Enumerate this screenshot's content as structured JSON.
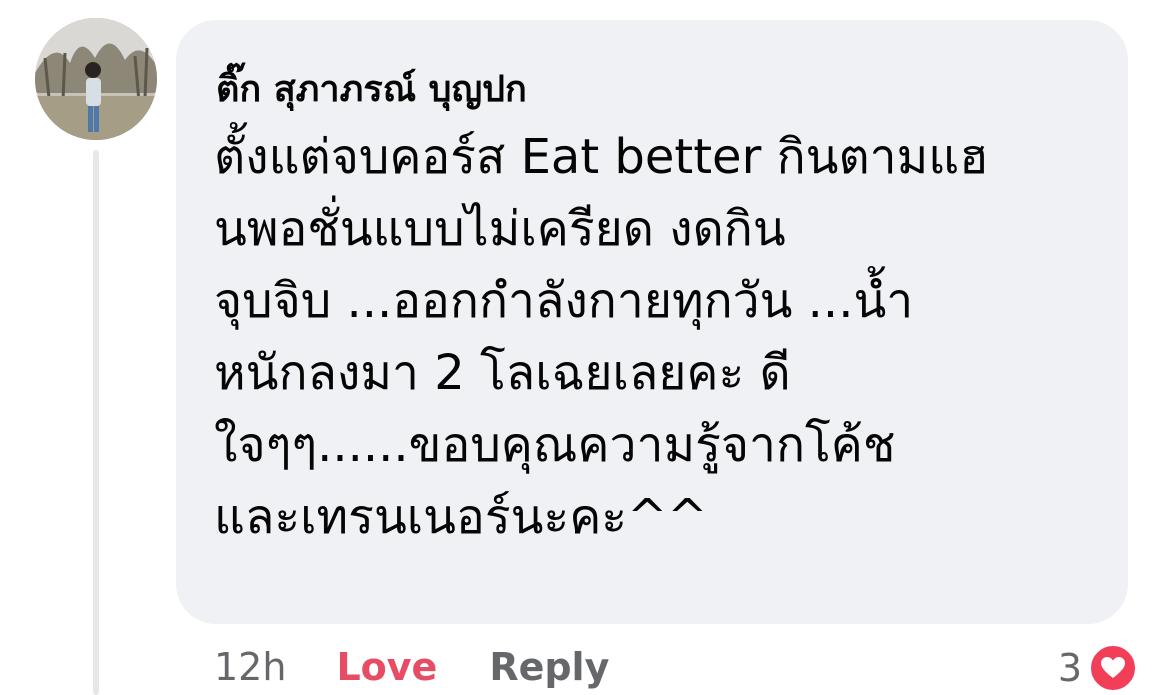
{
  "comment": {
    "author": "ติ๊ก สุภาภรณ์ บุญปก",
    "text_lines": [
      "ตั้งแต่จบคอร์ส Eat better กินตามแฮ",
      "นพอชั่นแบบไม่เครียด งดกิน",
      "จุบจิบ ...ออกกำลังกายทุกวัน ...น้ำ",
      "หนักลงมา 2 โลเฉยเลยคะ ดี",
      "ใจๆๆ......ขอบคุณความรู้จากโค้ช",
      "และเทรนเนอร์นะคะ^^"
    ]
  },
  "actions": {
    "time": "12h",
    "love_label": "Love",
    "reply_label": "Reply"
  },
  "reactions": {
    "count": "3",
    "icon": "heart-icon",
    "color": "#f33e58"
  },
  "colors": {
    "bubble": "#f0f1f5",
    "love": "#e64c64",
    "muted": "#65676b"
  }
}
